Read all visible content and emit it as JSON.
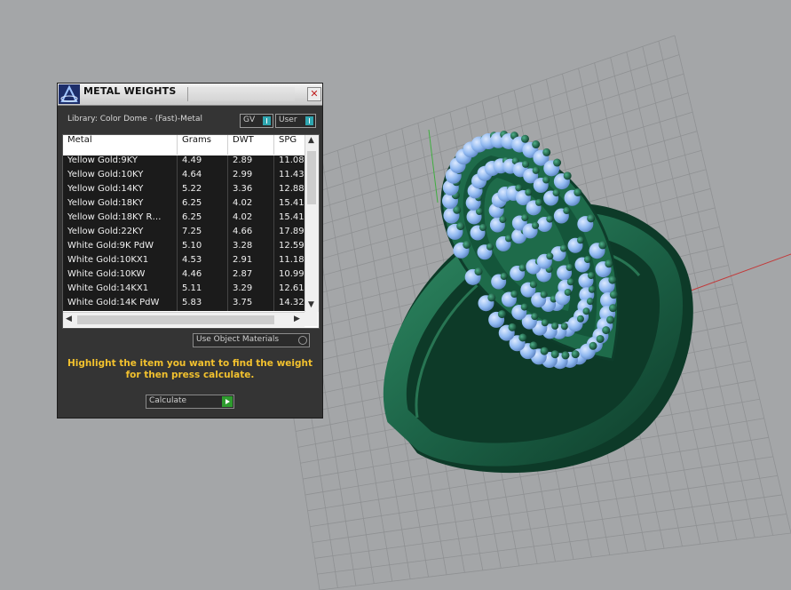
{
  "panel": {
    "title": "METAL WEIGHTS",
    "close_label": "✕",
    "library_label": "Library: Color Dome - (Fast)-Metal",
    "toggles": [
      {
        "label": "GV"
      },
      {
        "label": "User"
      }
    ],
    "table": {
      "columns": [
        "Metal",
        "Grams",
        "DWT",
        "SPG"
      ],
      "rows": [
        [
          "Yellow Gold:9KY",
          "4.49",
          "2.89",
          "11.08"
        ],
        [
          "Yellow Gold:10KY",
          "4.64",
          "2.99",
          "11.43"
        ],
        [
          "Yellow Gold:14KY",
          "5.22",
          "3.36",
          "12.88"
        ],
        [
          "Yellow Gold:18KY",
          "6.25",
          "4.02",
          "15.41"
        ],
        [
          "Yellow Gold:18KY R…",
          "6.25",
          "4.02",
          "15.41"
        ],
        [
          "Yellow Gold:22KY",
          "7.25",
          "4.66",
          "17.89"
        ],
        [
          "White Gold:9K PdW",
          "5.10",
          "3.28",
          "12.59"
        ],
        [
          "White Gold:10KX1",
          "4.53",
          "2.91",
          "11.18"
        ],
        [
          "White Gold:10KW",
          "4.46",
          "2.87",
          "10.99"
        ],
        [
          "White Gold:14KX1",
          "5.11",
          "3.29",
          "12.61"
        ],
        [
          "White Gold:14K PdW",
          "5.83",
          "3.75",
          "14.32"
        ]
      ]
    },
    "use_object_materials_label": "Use Object Materials",
    "instruction": "Highlight the item you want to find the weight for then press calculate.",
    "calculate_label": "Calculate"
  },
  "colors": {
    "panel_bg": "#343434",
    "instruction_text": "#f2c12e",
    "ring_metal": "#1f6b4c",
    "gems": "#8fb8f0",
    "viewport_bg": "#a4a6a8",
    "toggle_accent": "#2fa6b0"
  },
  "icons": [
    "app-logo-icon",
    "close-icon",
    "scroll-up-icon",
    "scroll-down-icon",
    "scroll-left-icon",
    "scroll-right-icon",
    "play-icon"
  ]
}
